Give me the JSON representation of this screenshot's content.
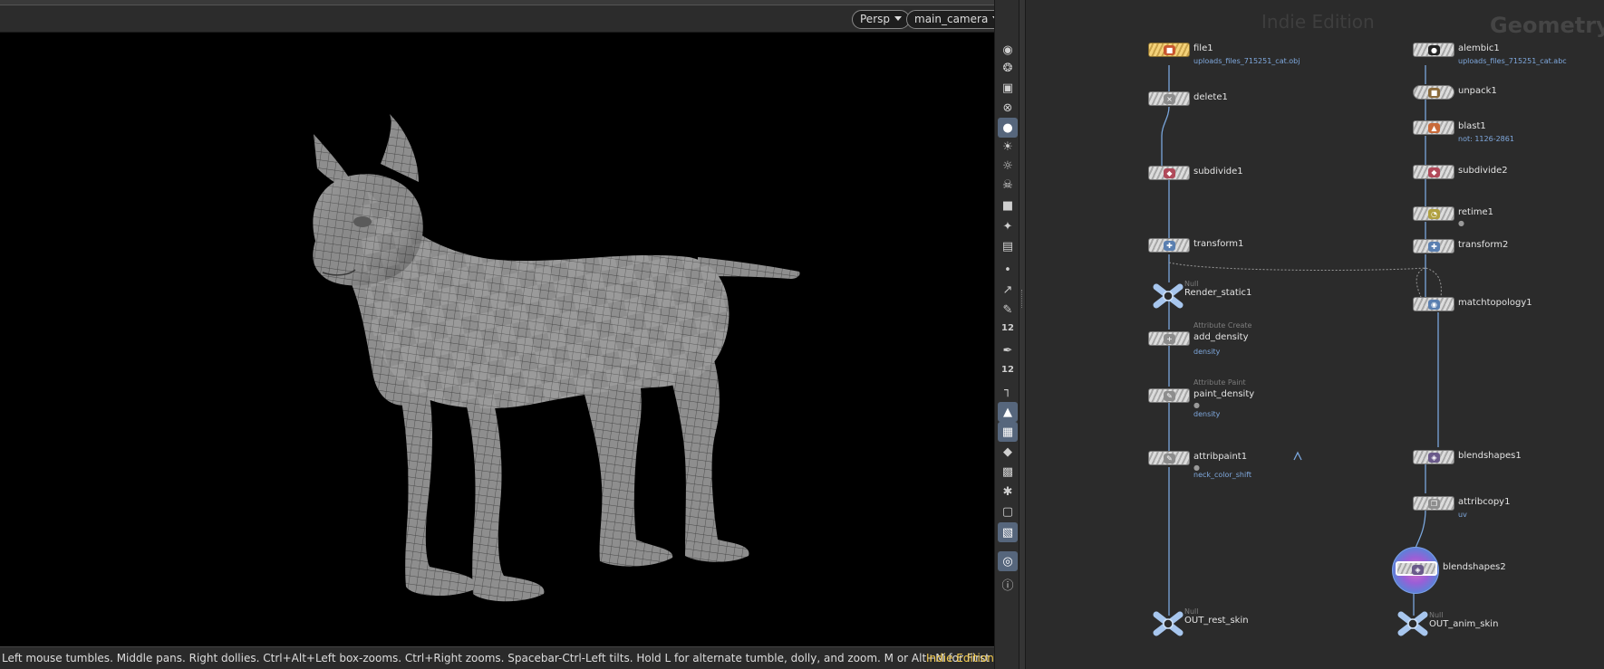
{
  "viewport": {
    "view_menu": "Persp",
    "camera_menu": "main_camera",
    "status_hint": "Left mouse tumbles. Middle pans. Right dollies. Ctrl+Alt+Left box-zooms. Ctrl+Right zooms. Spacebar-Ctrl-Left tilts. Hold L for alternate tumble, dolly, and zoom.    M or Alt+M for First Person Navigation.",
    "status_edition": "Indie Edition"
  },
  "toolbar": {
    "items": [
      {
        "icon": "eye-icon",
        "active": false
      },
      {
        "icon": "ghost-view-icon",
        "active": false
      },
      {
        "icon": "lock-icon",
        "active": false
      },
      {
        "icon": "close-circle-icon",
        "active": false
      },
      {
        "icon": "shading-sphere-icon",
        "active": true
      },
      {
        "icon": "light-bulb-icon",
        "active": false
      },
      {
        "icon": "headlight-icon",
        "active": false
      },
      {
        "icon": "skull-icon",
        "active": false
      },
      {
        "icon": "camera-icon",
        "active": false
      },
      {
        "icon": "transform-handle-icon",
        "active": false
      },
      {
        "icon": "capture-icon",
        "active": false
      },
      {
        "icon": "point-icon",
        "active": false
      },
      {
        "icon": "normal-icon",
        "active": false
      },
      {
        "icon": "brush-icon",
        "active": false
      },
      {
        "icon": "number-12-icon",
        "label": "12",
        "active": false
      },
      {
        "icon": "paint-icon",
        "active": false
      },
      {
        "icon": "number-12b-icon",
        "label": "12",
        "active": false
      },
      {
        "icon": "edge-icon",
        "active": false
      },
      {
        "icon": "wireframe-icon",
        "active": true
      },
      {
        "icon": "grid-icon",
        "active": true
      },
      {
        "icon": "diamond-icon",
        "active": false
      },
      {
        "icon": "texture-icon",
        "active": false
      },
      {
        "icon": "joint-icon",
        "active": false
      },
      {
        "icon": "frame-icon",
        "active": false
      },
      {
        "icon": "snapshot-icon",
        "active": true
      },
      {
        "icon": "pin-icon",
        "active": true
      },
      {
        "icon": "info-icon",
        "active": false
      }
    ]
  },
  "network": {
    "watermark": "Indie Edition",
    "context": "Geometry",
    "nodes": [
      {
        "id": "file1",
        "name": "file1",
        "sub": "uploads_files_715251_cat.obj",
        "style": "yellow"
      },
      {
        "id": "delete1",
        "name": "delete1"
      },
      {
        "id": "subdivide1",
        "name": "subdivide1"
      },
      {
        "id": "transform1",
        "name": "transform1"
      },
      {
        "id": "render_static1",
        "name": "Render_static1",
        "type": "Null"
      },
      {
        "id": "add_density",
        "name": "add_density",
        "type": "Attribute Create",
        "sub": "density"
      },
      {
        "id": "paint_density",
        "name": "paint_density",
        "type": "Attribute Paint",
        "sub": "density"
      },
      {
        "id": "attribpaint1",
        "name": "attribpaint1",
        "sub": "neck_color_shift"
      },
      {
        "id": "out_rest_skin",
        "name": "OUT_rest_skin",
        "type": "Null"
      },
      {
        "id": "alembic1",
        "name": "alembic1",
        "sub": "uploads_files_715251_cat.abc"
      },
      {
        "id": "unpack1",
        "name": "unpack1"
      },
      {
        "id": "blast1",
        "name": "blast1",
        "sub": "not: 1126-2861"
      },
      {
        "id": "subdivide2",
        "name": "subdivide2"
      },
      {
        "id": "retime1",
        "name": "retime1"
      },
      {
        "id": "transform2",
        "name": "transform2"
      },
      {
        "id": "matchtopology1",
        "name": "matchtopology1"
      },
      {
        "id": "blendshapes1",
        "name": "blendshapes1"
      },
      {
        "id": "attribcopy1",
        "name": "attribcopy1",
        "sub": "uv"
      },
      {
        "id": "blendshapes2",
        "name": "blendshapes2"
      },
      {
        "id": "out_anim_skin",
        "name": "OUT_anim_skin",
        "type": "Null"
      }
    ]
  }
}
